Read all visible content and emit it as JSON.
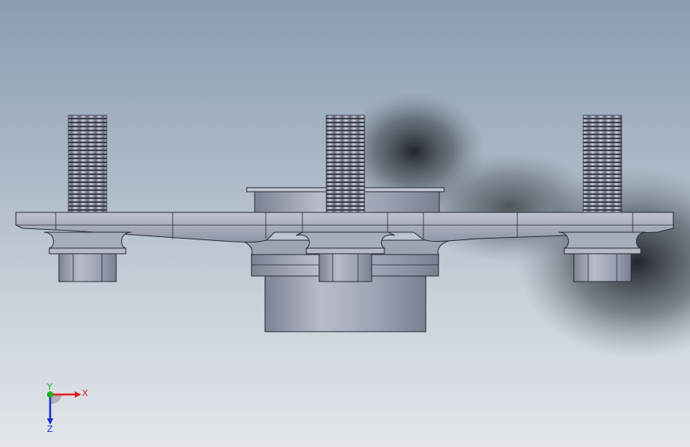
{
  "viewport": {
    "background_top": "#8a9db2",
    "background_bottom": "#e2e6ea",
    "model_color": "#a3a8b8"
  },
  "triad": {
    "x_label": "X",
    "y_label": "Y",
    "z_label": "Z",
    "x_color": "#e02020",
    "y_color": "#20b020",
    "z_color": "#2030d0"
  }
}
